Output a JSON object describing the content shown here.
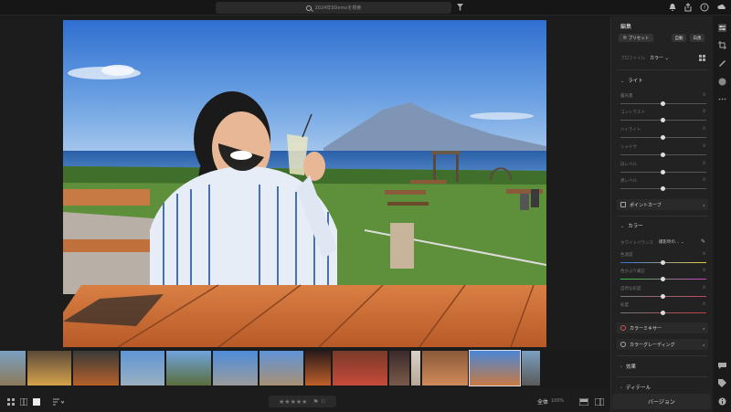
{
  "search": {
    "placeholder": "2024年9Demoを検索"
  },
  "panel": {
    "title": "編集",
    "preset_label": "プリセット",
    "auto_label": "自動",
    "bw_label": "白黒",
    "profile_label": "プロファイル",
    "profile_value": "カラー",
    "light_section": "ライト",
    "light_sliders": [
      {
        "label": "露光量",
        "value": "0"
      },
      {
        "label": "コントラスト",
        "value": "0"
      },
      {
        "label": "ハイライト",
        "value": "0"
      },
      {
        "label": "シャドウ",
        "value": "0"
      },
      {
        "label": "白レベル",
        "value": "0"
      },
      {
        "label": "黒レベル",
        "value": "0"
      }
    ],
    "point_curve": "ポイントカーブ",
    "color_section": "カラー",
    "wb_label": "ホワイトバランス",
    "wb_value": "撮影時の…",
    "color_sliders": [
      {
        "label": "色温度",
        "value": "0"
      },
      {
        "label": "色かぶり補正",
        "value": "0"
      },
      {
        "label": "自然な彩度",
        "value": "0"
      },
      {
        "label": "彩度",
        "value": "0"
      }
    ],
    "color_mixer": "カラーミキサー",
    "color_grading": "カラーグレーディング",
    "effects_section": "効果",
    "detail_section": "ディテール",
    "version_label": "バージョン"
  },
  "bottom": {
    "stars": "★★★★★",
    "fit_label": "全体",
    "zoom_value": "100%"
  },
  "colors": {
    "sky": "#4a86d6",
    "accent": "#e0e0e0"
  }
}
